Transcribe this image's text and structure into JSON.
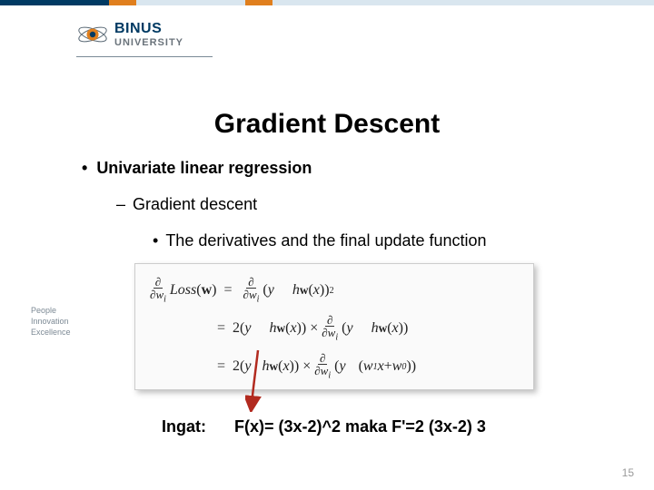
{
  "brand": {
    "line1": "BINUS",
    "line2": "UNIVERSITY"
  },
  "title": "Gradient Descent",
  "bullets": {
    "b1": "Univariate linear regression",
    "b2": "Gradient descent",
    "b3": "The derivatives and the final update function"
  },
  "formula": {
    "loss": "Loss",
    "w": "w",
    "y": "y",
    "hw": "h",
    "x": "x",
    "w1": "w",
    "w0": "w",
    "partial": "∂",
    "two": "2",
    "s1": "1",
    "s0": "0",
    "i": "i"
  },
  "ingat": {
    "label": "Ingat:",
    "expr": "F(x)= (3x-2)^2 maka F'=2 (3x-2) 3"
  },
  "pie": {
    "l1": "People",
    "l2": "Innovation",
    "l3": "Excellence"
  },
  "page": "15"
}
